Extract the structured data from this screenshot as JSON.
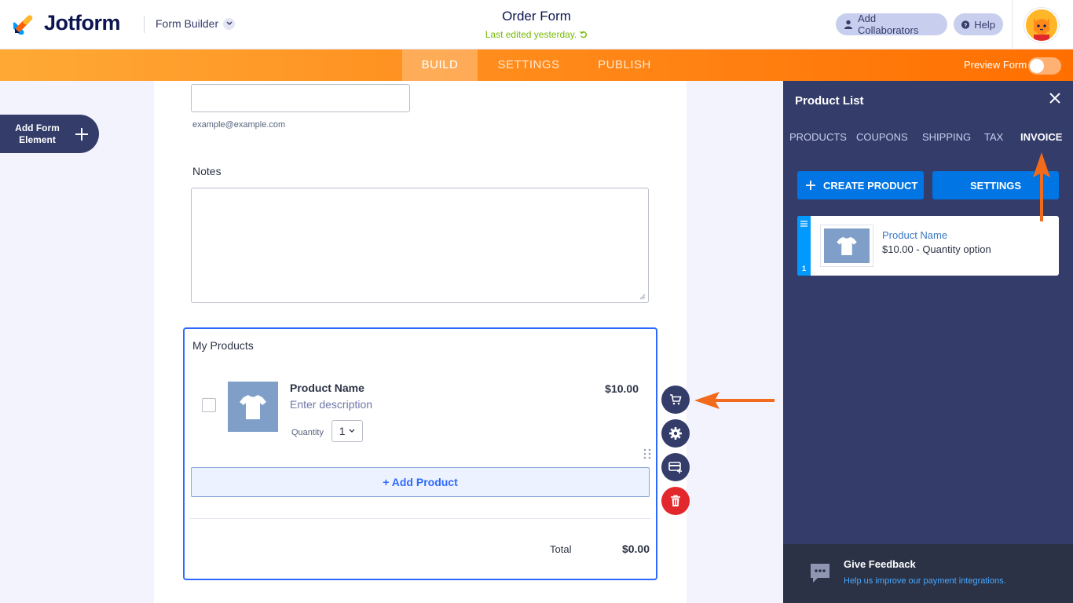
{
  "header": {
    "brand": "Jotform",
    "builder_label": "Form Builder",
    "form_title": "Order Form",
    "last_edited": "Last edited yesterday.",
    "add_collaborators": "Add Collaborators",
    "help": "Help"
  },
  "nav": {
    "tabs": [
      "BUILD",
      "SETTINGS",
      "PUBLISH"
    ],
    "active_tab": "BUILD",
    "preview_label": "Preview Form"
  },
  "add_element": {
    "label": "Add Form Element"
  },
  "form": {
    "email_sublabel": "example@example.com",
    "notes_label": "Notes",
    "products": {
      "title": "My Products",
      "item_name": "Product Name",
      "item_description": "Enter description",
      "item_price": "$10.00",
      "quantity_label": "Quantity",
      "quantity_value": "1",
      "add_product": "+ Add Product",
      "total_label": "Total",
      "total_value": "$0.00"
    }
  },
  "panel": {
    "title": "Product List",
    "tabs": [
      "PRODUCTS",
      "COUPONS",
      "SHIPPING",
      "TAX",
      "INVOICE"
    ],
    "active_tab": "INVOICE",
    "create_button": "CREATE PRODUCT",
    "settings_button": "SETTINGS",
    "product": {
      "index": "1",
      "name": "Product Name",
      "meta": "$10.00 - Quantity option"
    },
    "feedback": {
      "title": "Give Feedback",
      "link": "Help us improve our payment integrations."
    }
  },
  "colors": {
    "accent_orange": "#ff6f00",
    "panel_bg": "#343c6a",
    "primary_blue": "#0075e3",
    "focus_blue": "#2e69ff",
    "delete_red": "#e3282d"
  }
}
